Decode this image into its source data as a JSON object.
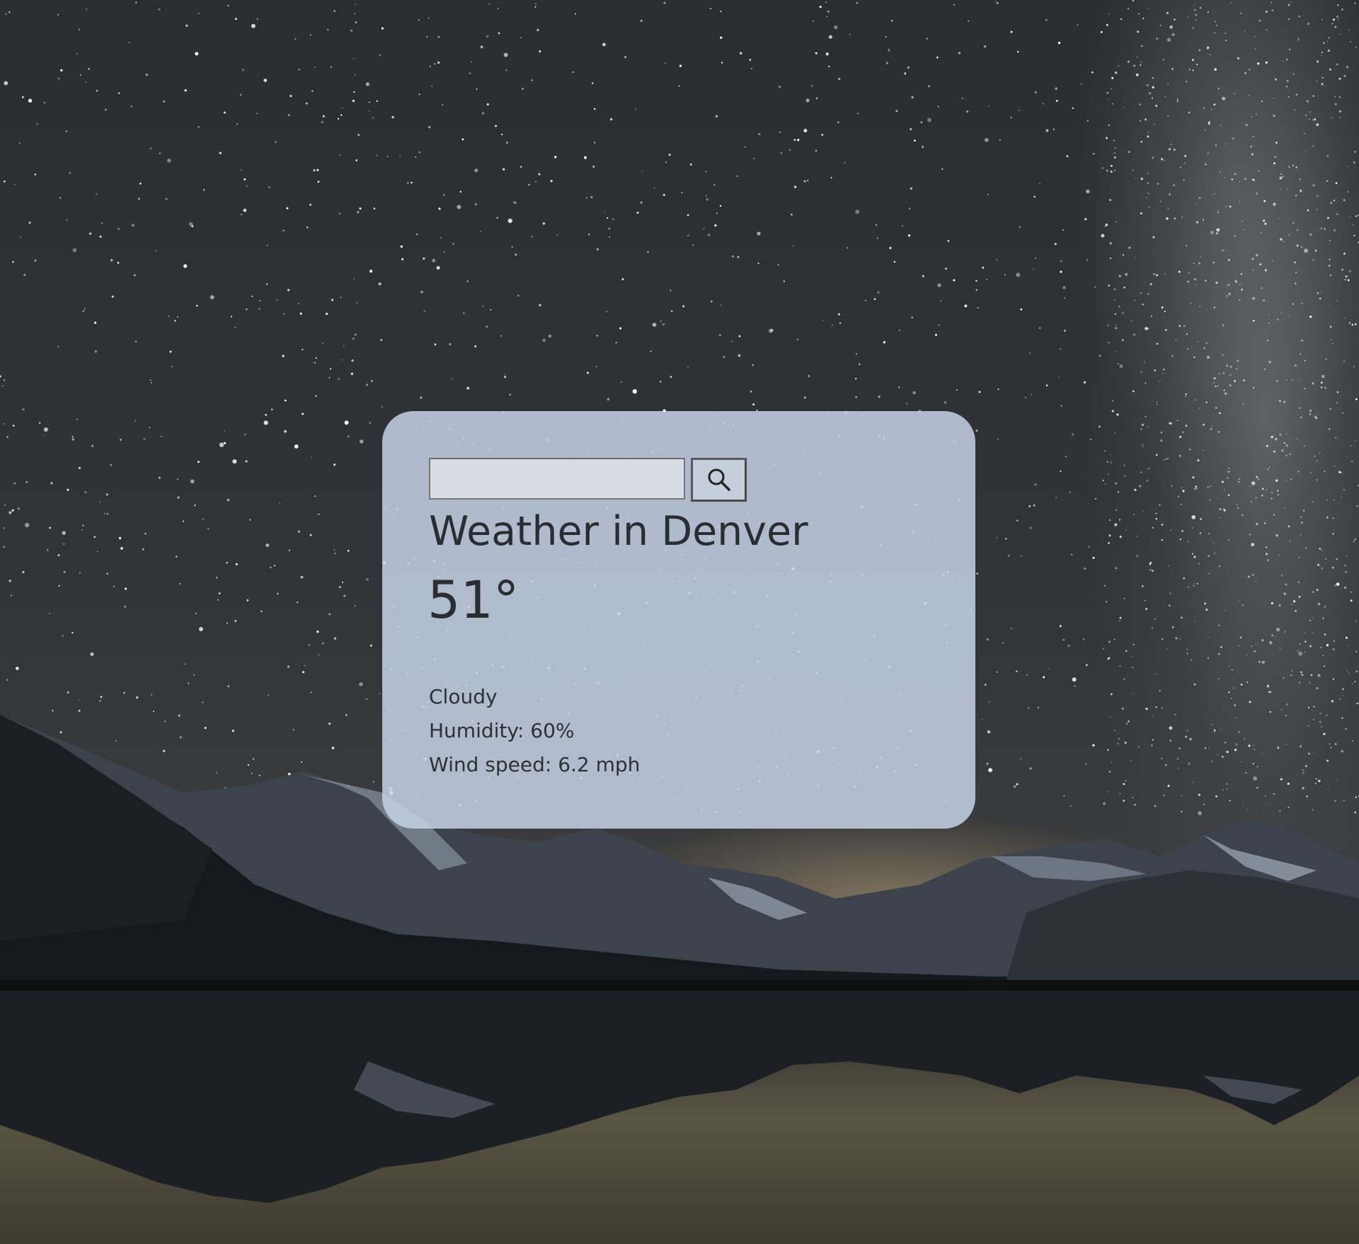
{
  "search": {
    "value": "",
    "placeholder": "",
    "button_icon": "search-icon"
  },
  "weather": {
    "title": "Weather in Denver",
    "temperature": "51°",
    "description": "Cloudy",
    "humidity": "Humidity: 60%",
    "wind": "Wind speed: 6.2 mph"
  },
  "colors": {
    "card_background": "#c6d4e8",
    "text": "#2a2d31"
  }
}
